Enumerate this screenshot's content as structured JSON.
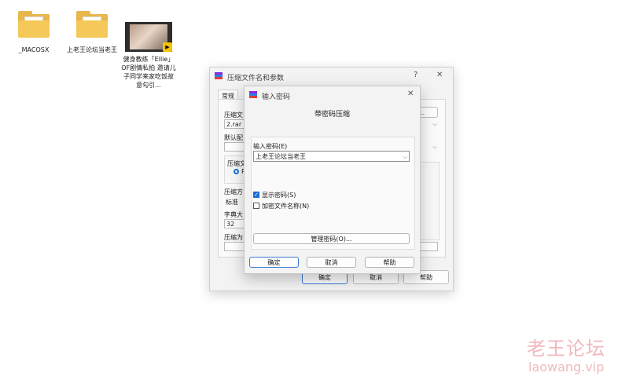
{
  "desktop": {
    "items": [
      {
        "label": "_MACOSX",
        "icon": "folder-icon"
      },
      {
        "label": "上老王论坛当老王",
        "icon": "folder-icon"
      },
      {
        "label": "健身教练「Ellie」OF剧情私拍 邀请儿子同学来家吃饭故意勾引...",
        "icon": "video-file-icon"
      }
    ]
  },
  "back_dialog": {
    "title": "压缩文件名和参数",
    "help_label": "?",
    "close_label": "✕",
    "tab_general": "常规",
    "archive_name_label": "压缩文",
    "archive_name_value": "2.rar",
    "browse_label": "B)...",
    "default_profile_label": "默认配",
    "format_label": "压缩文",
    "radio_label": "R",
    "method_label": "压缩方",
    "method_value": "标准",
    "dict_label": "字典大",
    "dict_value": "32",
    "split_label": "压缩为",
    "ok_label": "确定",
    "cancel_label": "取消",
    "help_button_label": "帮助"
  },
  "front_dialog": {
    "title": "输入密码",
    "close_label": "✕",
    "heading": "带密码压缩",
    "password_label": "输入密码(E)",
    "password_value": "上老王论坛当老王",
    "show_password_label": "显示密码(S)",
    "show_password_checked": true,
    "encrypt_names_label": "加密文件名称(N)",
    "encrypt_names_checked": false,
    "organize_label": "管理密码(O)...",
    "ok_label": "确定",
    "cancel_label": "取消",
    "help_label": "帮助"
  },
  "watermark": {
    "main": "老王论坛",
    "sub": "laowang.vip"
  },
  "colors": {
    "accent": "#1a6fd6",
    "folder": "#f5c85a",
    "watermark": "#f1b8bc"
  }
}
